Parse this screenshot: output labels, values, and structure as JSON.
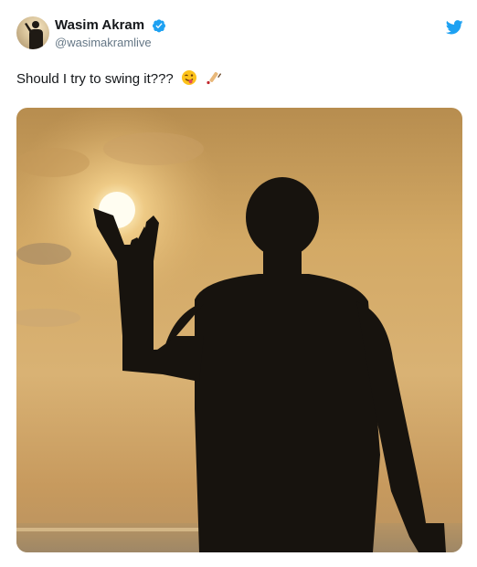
{
  "tweet": {
    "author_name": "Wasim Akram",
    "author_handle": "@wasimakramlive",
    "text": "Should I try to swing it???",
    "emojis": [
      "winking-face-with-tongue-icon",
      "cricket-bat-icon"
    ],
    "verified": true
  },
  "icons": {
    "avatar": "user-avatar",
    "verified": "verified-badge-icon",
    "platform": "twitter-bird-icon"
  },
  "colors": {
    "brand_blue": "#1da1f2",
    "name_text": "#14171a",
    "handle_text": "#657786",
    "verified": "#1da1f2"
  },
  "media": {
    "type": "photo"
  }
}
